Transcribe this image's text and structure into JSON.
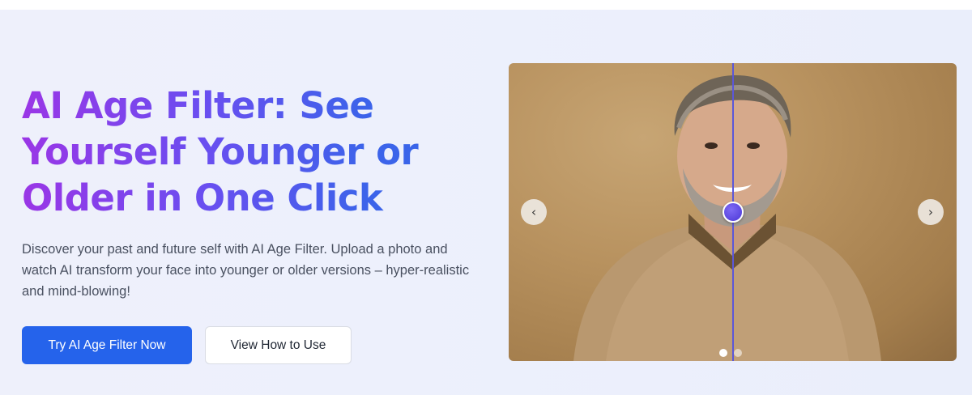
{
  "hero": {
    "title_lines": [
      "AI Age Filter: See",
      "Yourself Younger or",
      "Older in One Click"
    ],
    "description": "Discover your past and future self with AI Age Filter. Upload a photo and watch AI transform your face into younger or older versions – hyper-realistic and mind-blowing!",
    "primary_button": "Try AI Age Filter Now",
    "secondary_button": "View How to Use"
  },
  "carousel": {
    "prev_icon": "‹",
    "next_icon": "›",
    "slide_count": 2,
    "active_slide": 1,
    "image_description": "before-after comparison portrait of a smiling man in a beige sweater"
  },
  "colors": {
    "primary_button": "#2563eb",
    "title_gradient_start": "#9a36e6",
    "title_gradient_end": "#3667e8",
    "slider_handle": "#5a46df"
  }
}
